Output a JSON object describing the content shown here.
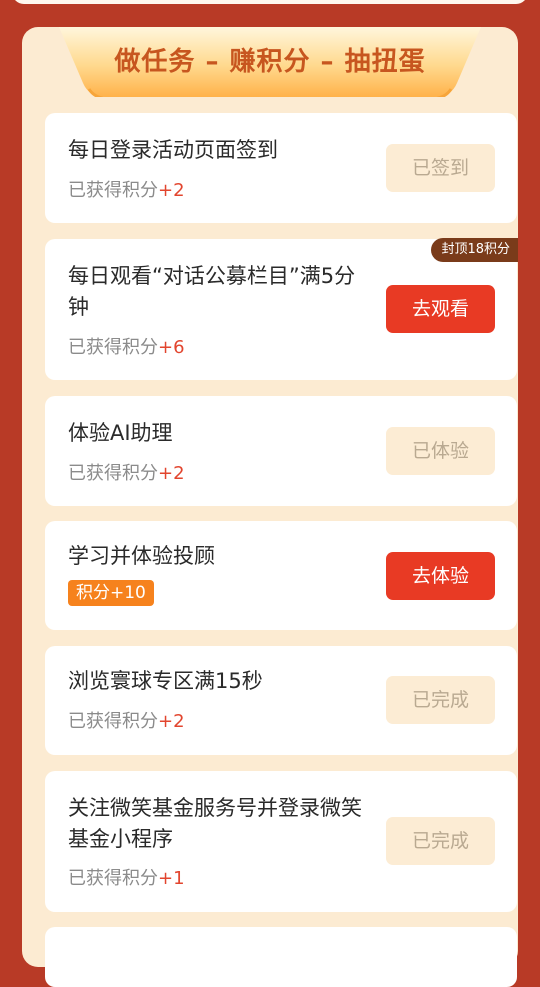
{
  "banner": {
    "title": "做任务 – 赚积分 – 抽扭蛋"
  },
  "tasks": [
    {
      "title": "每日登录活动页面签到",
      "earned_prefix": "已获得积分",
      "earned_value": "+2",
      "button": "已签到"
    },
    {
      "title": "每日观看“对话公募栏目”满5分钟",
      "earned_prefix": "已获得积分",
      "earned_value": "+6",
      "button": "去观看",
      "cap_badge": "封顶18积分"
    },
    {
      "title": "体验AI助理",
      "earned_prefix": "已获得积分",
      "earned_value": "+2",
      "button": "已体验"
    },
    {
      "title": "学习并体验投顾",
      "points_badge": "积分+10",
      "button": "去体验"
    },
    {
      "title": "浏览寰球专区满15秒",
      "earned_prefix": "已获得积分",
      "earned_value": "+2",
      "button": "已完成"
    },
    {
      "title": "关注微笑基金服务号并登录微笑基金小程序",
      "earned_prefix": "已获得积分",
      "earned_value": "+1",
      "button": "已完成"
    }
  ],
  "colors": {
    "page_background": "#b83a26",
    "panel_background": "#fcebd2",
    "action_button": "#e83a24",
    "done_button": "#fcecd4",
    "points_highlight": "#e2452e",
    "points_badge": "#f6821d"
  }
}
